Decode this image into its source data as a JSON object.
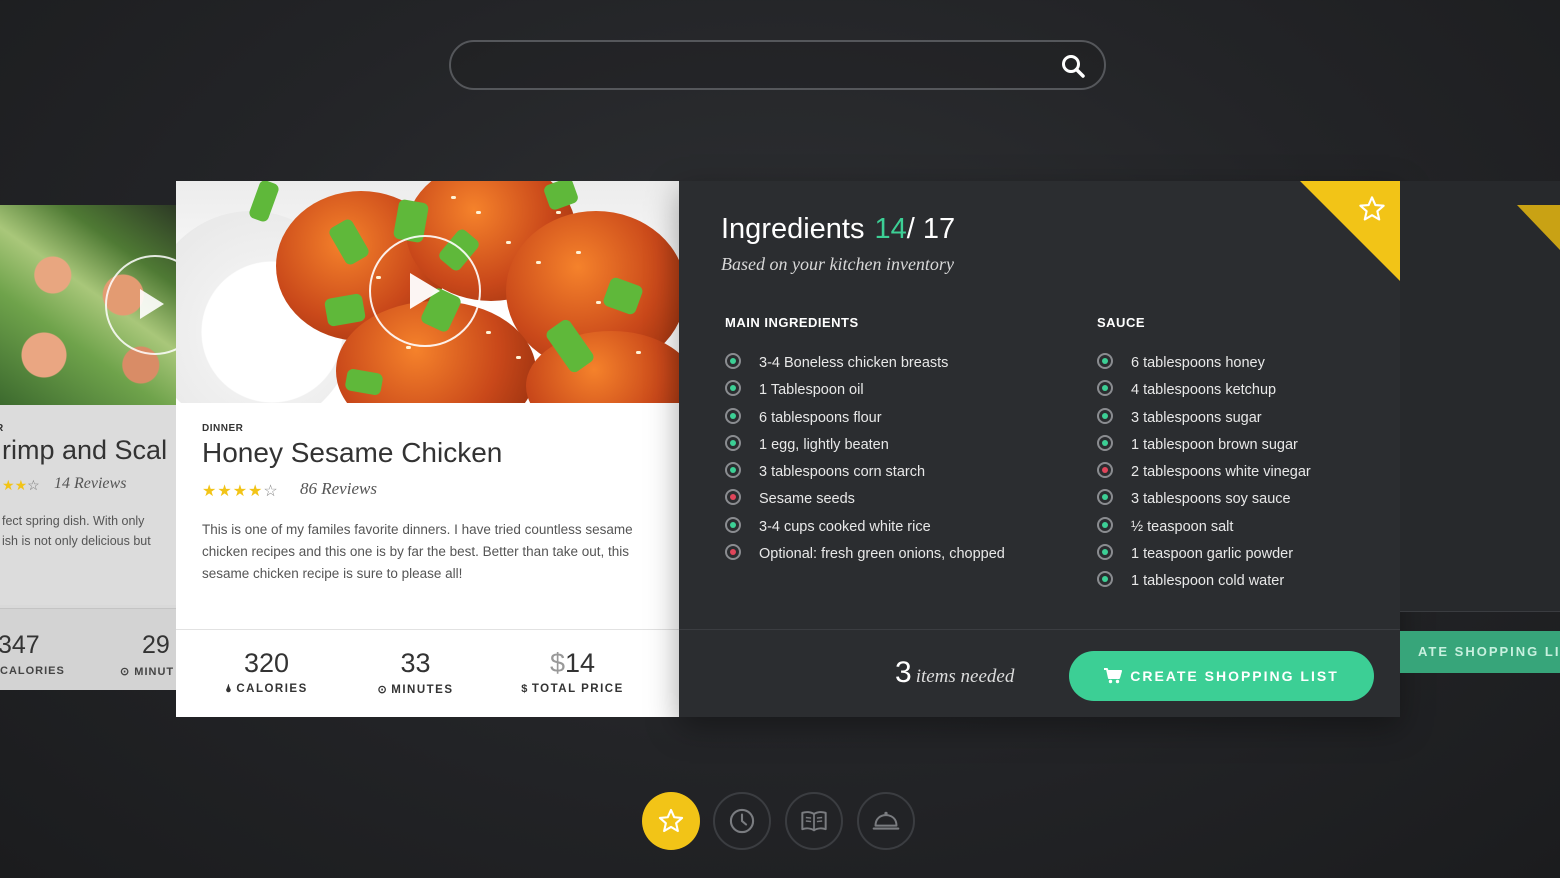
{
  "search": {
    "placeholder": "",
    "icon": "search-icon"
  },
  "left_card": {
    "category": "R",
    "title": "rimp and Scal",
    "stars_filled": 2.5,
    "stars_total": 5,
    "reviews": "14 Reviews",
    "description_line1": "fect spring dish. With only",
    "description_line2": "ish is not only delicious but",
    "calories": "347",
    "calories_label": "CALORIES",
    "minutes": "29",
    "minutes_label": "MINUT"
  },
  "recipe": {
    "category": "DINNER",
    "title": "Honey Sesame Chicken",
    "stars_filled": 4,
    "stars_total": 5,
    "reviews": "86 Reviews",
    "description": "This is one of my familes favorite dinners. I have tried countless sesame chicken recipes and this one is by far the best. Better than take out, this sesame chicken recipe is sure to please all!",
    "stats": {
      "calories": "320",
      "calories_label": "CALORIES",
      "minutes": "33",
      "minutes_label": "MINUTES",
      "price_symbol": "$",
      "price": "14",
      "price_label": "TOTAL PRICE",
      "price_label_symbol": "$"
    }
  },
  "ingredients": {
    "title": "Ingredients",
    "have": "14",
    "total": "/ 17",
    "subtitle": "Based on your kitchen inventory",
    "main_heading": "MAIN INGREDIENTS",
    "main": [
      {
        "text": "3-4 Boneless chicken breasts",
        "status": "have"
      },
      {
        "text": "1 Tablespoon oil",
        "status": "have"
      },
      {
        "text": "6 tablespoons flour",
        "status": "have"
      },
      {
        "text": "1 egg, lightly beaten",
        "status": "have"
      },
      {
        "text": "3 tablespoons corn starch",
        "status": "have"
      },
      {
        "text": "Sesame seeds",
        "status": "missing"
      },
      {
        "text": "3-4 cups cooked white rice",
        "status": "have"
      },
      {
        "text": "Optional: fresh green onions, chopped",
        "status": "missing"
      }
    ],
    "sauce_heading": "SAUCE",
    "sauce": [
      {
        "text": "6 tablespoons honey",
        "status": "have"
      },
      {
        "text": "4 tablespoons ketchup",
        "status": "have"
      },
      {
        "text": "3 tablespoons sugar",
        "status": "have"
      },
      {
        "text": "1 tablespoon brown sugar",
        "status": "have"
      },
      {
        "text": "2 tablespoons white vinegar",
        "status": "missing"
      },
      {
        "text": "3 tablespoons soy sauce",
        "status": "have"
      },
      {
        "text": "½ teaspoon salt",
        "status": "have"
      },
      {
        "text": "1 teaspoon garlic powder",
        "status": "have"
      },
      {
        "text": "1 tablespoon cold water",
        "status": "have"
      }
    ],
    "items_needed_count": "3",
    "items_needed_text": "items needed",
    "cta_label": "CREATE SHOPPING LIST"
  },
  "peek": {
    "cta_label": "ATE SHOPPING LIST"
  },
  "nav": [
    {
      "name": "favorites",
      "icon": "star-icon",
      "active": true
    },
    {
      "name": "recent",
      "icon": "clock-icon",
      "active": false
    },
    {
      "name": "recipes",
      "icon": "book-icon",
      "active": false
    },
    {
      "name": "dishes",
      "icon": "cloche-icon",
      "active": false
    }
  ],
  "colors": {
    "accent_green": "#3ccf95",
    "accent_yellow": "#f2c417",
    "missing_red": "#e0455a",
    "panel_dark": "#2b2d30"
  }
}
